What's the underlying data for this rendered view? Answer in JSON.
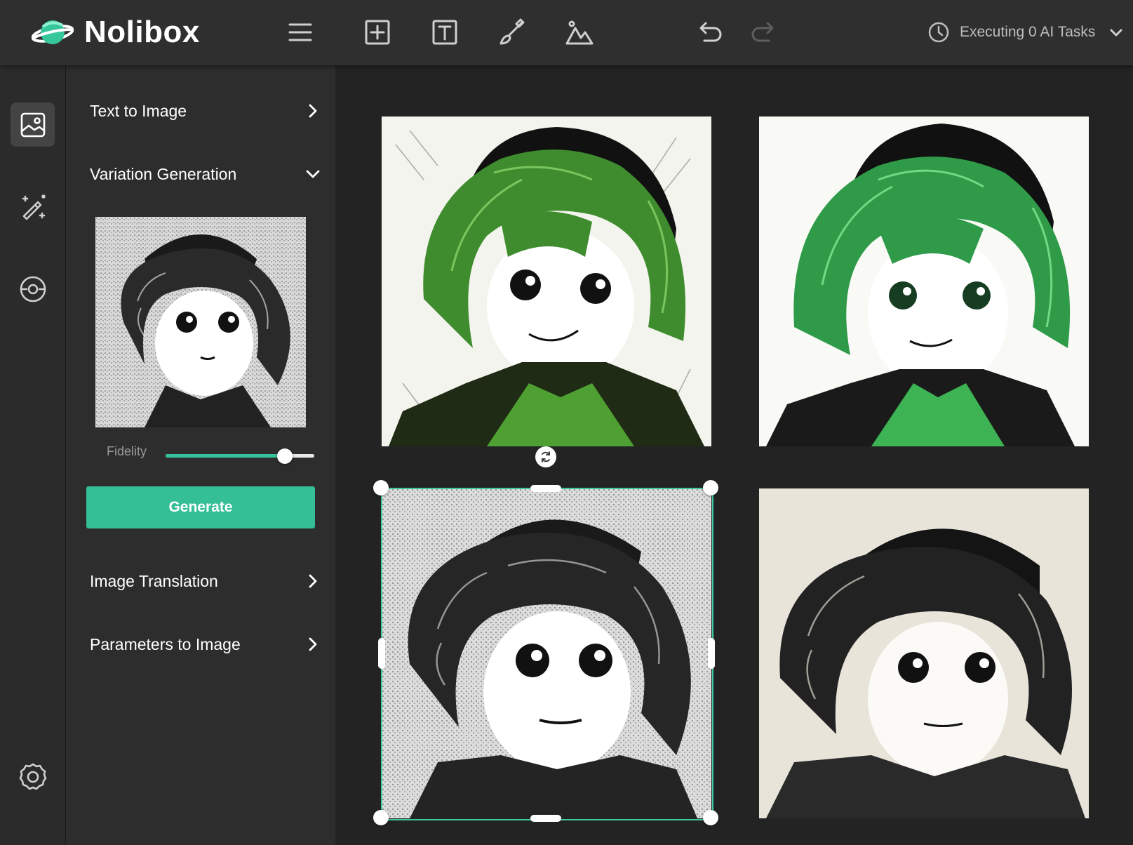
{
  "app": {
    "name": "Nolibox",
    "brand_color": "#35bf96"
  },
  "toolbar": {
    "icons": [
      "menu-icon",
      "add-frame-icon",
      "text-icon",
      "brush-icon",
      "image-icon",
      "undo-icon",
      "redo-icon"
    ],
    "tasks_label": "Executing 0 AI Tasks"
  },
  "rail": {
    "items": [
      "image-panel-icon",
      "magic-wand-icon",
      "ai-vision-icon",
      "settings-icon"
    ],
    "active": "image-panel-icon"
  },
  "panel": {
    "sections": {
      "text_to_image": "Text to Image",
      "variation_generation": "Variation Generation",
      "image_translation": "Image Translation",
      "parameters_to_image": "Parameters to Image"
    },
    "expanded": "variation_generation",
    "fidelity_label": "Fidelity",
    "fidelity_value": 0.8,
    "generate_label": "Generate"
  },
  "canvas": {
    "images": [
      {
        "name": "green-hair-variation-1",
        "style": "green"
      },
      {
        "name": "green-hair-variation-2",
        "style": "green"
      },
      {
        "name": "ink-sketch-original",
        "style": "ink",
        "selected": true
      },
      {
        "name": "ink-sketch-variation",
        "style": "sepia"
      }
    ]
  }
}
